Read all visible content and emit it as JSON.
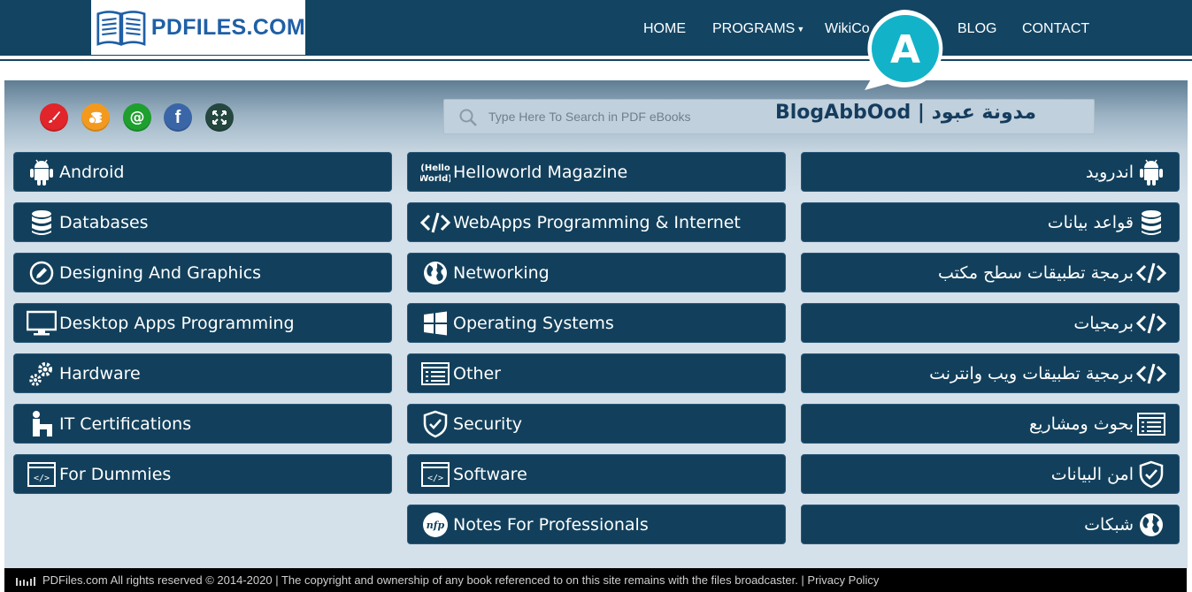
{
  "logo": {
    "text": "PDFILES.COM"
  },
  "nav": [
    {
      "label": "HOME"
    },
    {
      "label": "PROGRAMS"
    },
    {
      "label": "WikiCo"
    },
    {
      "label": "BLOG"
    },
    {
      "label": "CONTACT"
    }
  ],
  "badge": {
    "letter": "A"
  },
  "social": [
    "brush-icon",
    "coins-icon",
    "at-icon",
    "facebook-icon",
    "expand-icon"
  ],
  "search": {
    "placeholder": "Type Here To Search in PDF eBooks",
    "overlay": "BlogAbbOod | مدونة عبود"
  },
  "columns": {
    "left": [
      {
        "label": "Android",
        "icon": "android-icon"
      },
      {
        "label": "Databases",
        "icon": "database-icon"
      },
      {
        "label": "Designing And Graphics",
        "icon": "pen-circle-icon"
      },
      {
        "label": "Desktop Apps Programming",
        "icon": "monitor-icon"
      },
      {
        "label": "Hardware",
        "icon": "gears-icon"
      },
      {
        "label": "IT Certifications",
        "icon": "certificate-icon"
      },
      {
        "label": "For Dummies",
        "icon": "code-window-icon"
      }
    ],
    "middle": [
      {
        "label": "Helloworld Magazine",
        "icon": "helloworld-icon"
      },
      {
        "label": "WebApps Programming & Internet",
        "icon": "code-icon"
      },
      {
        "label": "Networking",
        "icon": "globe-icon"
      },
      {
        "label": "Operating Systems",
        "icon": "windows-icon"
      },
      {
        "label": "Other",
        "icon": "list-window-icon"
      },
      {
        "label": "Security",
        "icon": "shield-icon"
      },
      {
        "label": "Software",
        "icon": "code-window-icon"
      },
      {
        "label": "Notes For Professionals",
        "icon": "nfp-icon"
      }
    ],
    "right": [
      {
        "label": "اندرويد",
        "icon": "android-icon"
      },
      {
        "label": "قواعد بيانات",
        "icon": "database-icon"
      },
      {
        "label": "برمجة تطبيقات سطح مكتب",
        "icon": "code-icon"
      },
      {
        "label": "برمجيات",
        "icon": "code-icon"
      },
      {
        "label": "برمجية تطبيقات ويب وانترنت",
        "icon": "code-icon"
      },
      {
        "label": "بحوث ومشاريع",
        "icon": "list-window-icon"
      },
      {
        "label": "امن البيانات",
        "icon": "shield-icon"
      },
      {
        "label": "شبكات",
        "icon": "globe-icon"
      }
    ]
  },
  "footer": {
    "text": "PDFiles.com All rights reserved © 2014-2020 | The copyright and ownership of any book referenced to on this site remains with the files broadcaster. | Privacy Policy"
  },
  "colors": {
    "header": "#134563",
    "tile": "#12405c",
    "accent": "#1f5fa6"
  }
}
